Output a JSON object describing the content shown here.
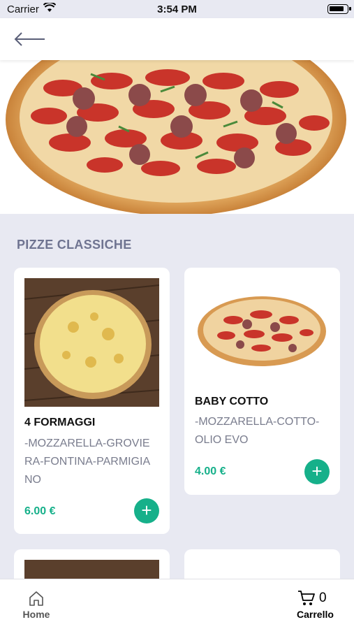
{
  "status_bar": {
    "carrier": "Carrier",
    "time": "3:54 PM"
  },
  "section": {
    "title": "PIZZE CLASSICHE"
  },
  "products": [
    {
      "name": "4 FORMAGGI",
      "description": "-MOZZARELLA-GROVIERA-FONTINA-PARMIGIANO",
      "price": "6.00 €",
      "add_label": "+"
    },
    {
      "name": "BABY COTTO",
      "description": "-MOZZARELLA-COTTO-OLIO EVO",
      "price": "4.00 €",
      "add_label": "+"
    }
  ],
  "tab_bar": {
    "home_label": "Home",
    "cart_label": "Carrello",
    "cart_count": "0"
  },
  "colors": {
    "accent": "#16b08a",
    "section_title": "#6f7491",
    "background": "#e8e9f2"
  },
  "icons": {
    "back": "arrow-left-icon",
    "home": "home-icon",
    "cart": "cart-icon",
    "add": "plus-icon",
    "wifi": "wifi-icon",
    "battery": "battery-icon"
  }
}
